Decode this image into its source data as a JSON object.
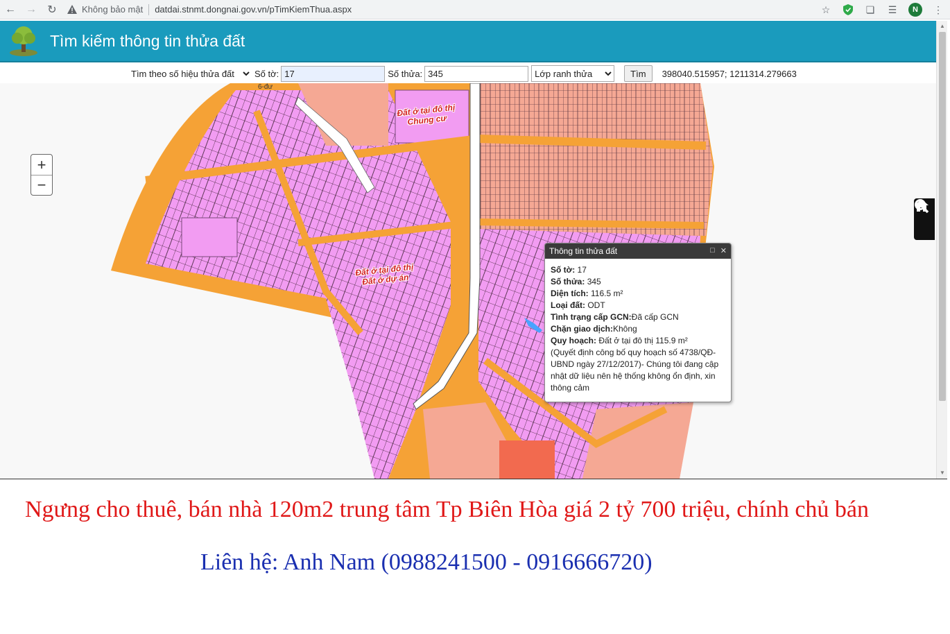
{
  "browser": {
    "security_label": "Không bảo mật",
    "url": "datdai.stnmt.dongnai.gov.vn/pTimKiemThua.aspx",
    "profile_initial": "N"
  },
  "app": {
    "title": "Tìm kiếm thông tin thửa đất"
  },
  "toolbar": {
    "search_mode": "Tìm theo số hiệu thửa đất",
    "so_to_label": "Số tờ:",
    "so_to_value": "17",
    "so_thua_label": "Số thửa:",
    "so_thua_value": "345",
    "layer_select": "Lớp ranh thửa",
    "search_button": "Tìm",
    "coordinates": "398040.515957; 1211314.279663"
  },
  "map": {
    "zoom_in": "+",
    "zoom_out": "−",
    "labels": {
      "zone_top_1": "Đất ở tại đô thị",
      "zone_top_2": "Chung cư",
      "zone_mid_1": "Đất ở tại đô thị",
      "zone_mid_2": "Đất ở dự án",
      "corner_fragment": "6-đư"
    },
    "colors": {
      "road": "#f5a236",
      "residential_pink": "#f29cf2",
      "salmon": "#f5a894",
      "red_block": "#f26a4f",
      "white_road": "#ffffff"
    }
  },
  "popup": {
    "title": "Thông tin thửa đất",
    "so_to_label": "Số tờ:",
    "so_to_value": " 17",
    "so_thua_label": "Số thửa:",
    "so_thua_value": " 345",
    "dien_tich_label": "Diện tích:",
    "dien_tich_value": " 116.5 m²",
    "loai_dat_label": "Loại đất:",
    "loai_dat_value": " ODT",
    "tinh_trang_label": "Tình trạng cấp GCN:",
    "tinh_trang_value": "Đã cấp GCN",
    "chan_giao_dich_label": "Chặn giao dịch:",
    "chan_giao_dich_value": "Không",
    "quy_hoach_label": "Quy hoạch:",
    "quy_hoach_value": " Đất ở tại đô thị 115.9 m²",
    "note": "(Quyết định công bố quy hoạch số 4738/QĐ-UBND ngày 27/12/2017)- Chúng tôi đang cập nhật dữ liệu nên hệ thống không ổn định, xin thông cảm"
  },
  "ad": {
    "line1": "Ngưng cho thuê, bán nhà 120m2 trung tâm Tp Biên Hòa giá 2 tỷ 700 triệu, chính chủ bán",
    "line2": "Liên hệ: Anh Nam (0988241500 - 0916666720)"
  }
}
